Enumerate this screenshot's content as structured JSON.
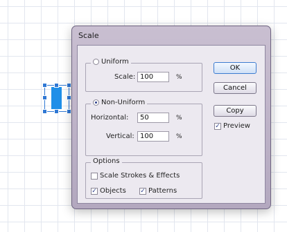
{
  "dialog": {
    "title": "Scale",
    "uniform": {
      "label": "Uniform",
      "selected": false,
      "scale_label": "Scale:",
      "scale_value": "100",
      "scale_unit": "%"
    },
    "non_uniform": {
      "label": "Non-Uniform",
      "selected": true,
      "horizontal_label": "Horizontal:",
      "horizontal_value": "50",
      "horizontal_unit": "%",
      "vertical_label": "Vertical:",
      "vertical_value": "100",
      "vertical_unit": "%"
    },
    "options": {
      "legend": "Options",
      "scale_strokes_label": "Scale Strokes & Effects",
      "scale_strokes_checked": false,
      "objects_label": "Objects",
      "objects_checked": true,
      "patterns_label": "Patterns",
      "patterns_checked": true
    },
    "buttons": {
      "ok": "OK",
      "cancel": "Cancel",
      "copy": "Copy"
    },
    "preview": {
      "label": "Preview",
      "checked": true
    }
  },
  "colors": {
    "selection": "#2f78d4",
    "shape_fill": "#1f8fe8",
    "dialog_frame": "#c9bfd1"
  }
}
